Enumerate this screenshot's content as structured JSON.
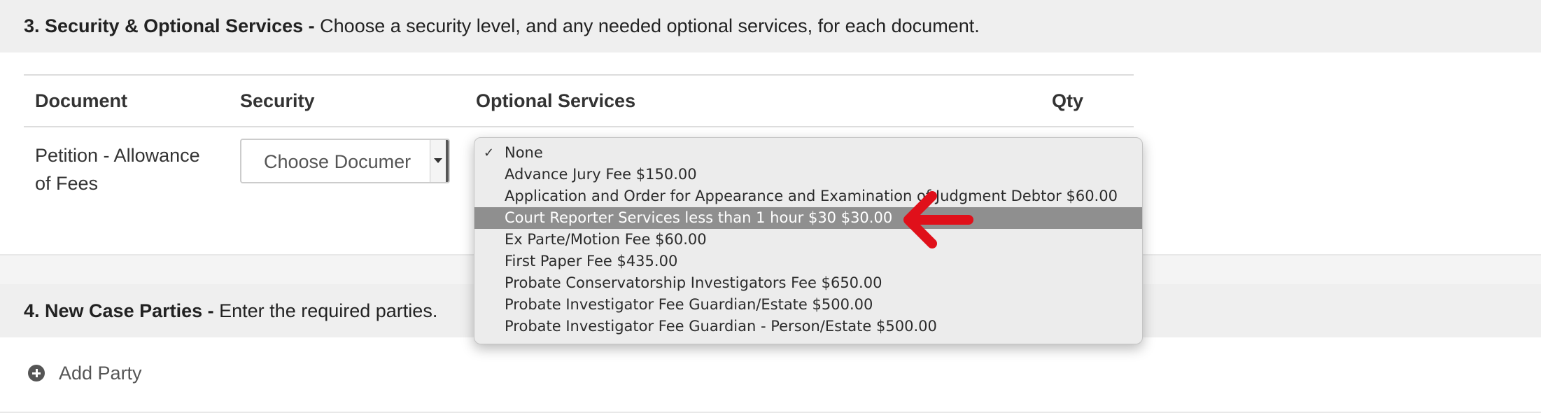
{
  "section3": {
    "number_title": "3. Security & Optional Services -",
    "description": " Choose a security level, and any needed optional services, for each document."
  },
  "table": {
    "headers": {
      "document": "Document",
      "security": "Security",
      "optional_services": "Optional Services",
      "qty": "Qty"
    },
    "row": {
      "document_line1": "Petition - Allowance",
      "document_line2": "of Fees",
      "security_value": "Choose Documer"
    }
  },
  "optional_services_dropdown": {
    "selected": "None",
    "highlighted": "Court Reporter Services less than 1 hour $30 $30.00",
    "options": [
      "None",
      "Advance Jury Fee $150.00",
      "Application and Order for Appearance and Examination of Judgment Debtor $60.00",
      "Court Reporter Services less than 1 hour $30 $30.00",
      "Ex Parte/Motion Fee $60.00",
      "First Paper Fee $435.00",
      "Probate Conservatorship Investigators Fee $650.00",
      "Probate Investigator Fee Guardian/Estate $500.00",
      "Probate Investigator Fee Guardian - Person/Estate $500.00"
    ]
  },
  "section4": {
    "number_title": "4. New Case Parties -",
    "description": " Enter the required parties.",
    "add_party_label": "Add Party"
  },
  "colors": {
    "arrow": "#e0101a",
    "highlight": "#8f8f8f",
    "section_header_bg": "#efefef"
  },
  "icons": {
    "check": "checkmark-icon",
    "arrow": "red-arrow-annotation",
    "add": "plus-circle-icon"
  }
}
